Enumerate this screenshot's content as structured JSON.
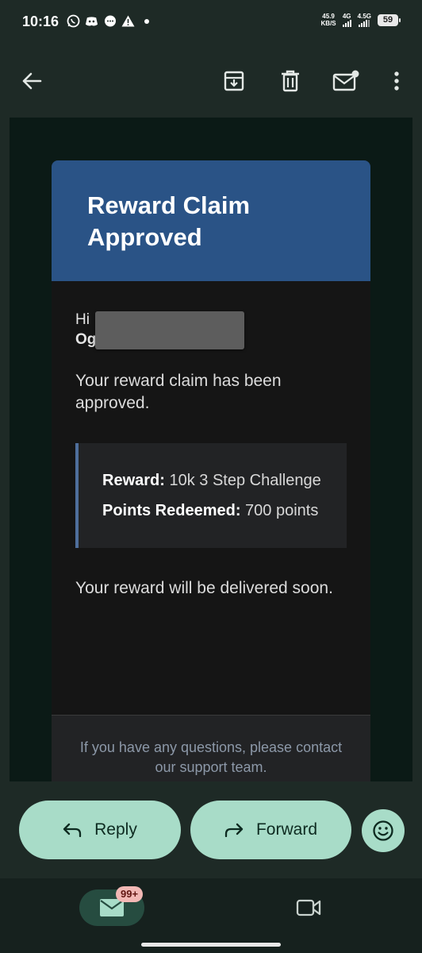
{
  "status_bar": {
    "time": "10:16",
    "net_speed_value": "45.9",
    "net_speed_unit": "KB/S",
    "net1": "4G",
    "net2": "4.5G",
    "battery": "59"
  },
  "email": {
    "title": "Reward Claim Approved",
    "greeting": "Hi",
    "name_visible": "Og",
    "message": "Your reward claim has been approved.",
    "reward_label": "Reward:",
    "reward_value": "10k 3 Step Challenge",
    "points_label": "Points Redeemed:",
    "points_value": "700 points",
    "delivery_message": "Your reward will be delivered soon.",
    "footer": "If you have any questions, please contact our support team."
  },
  "actions": {
    "reply": "Reply",
    "forward": "Forward"
  },
  "bottom_nav": {
    "mail_badge": "99+"
  },
  "colors": {
    "header": "#2a5386",
    "pill": "#a8dcc8",
    "background": "#1e2a26"
  }
}
